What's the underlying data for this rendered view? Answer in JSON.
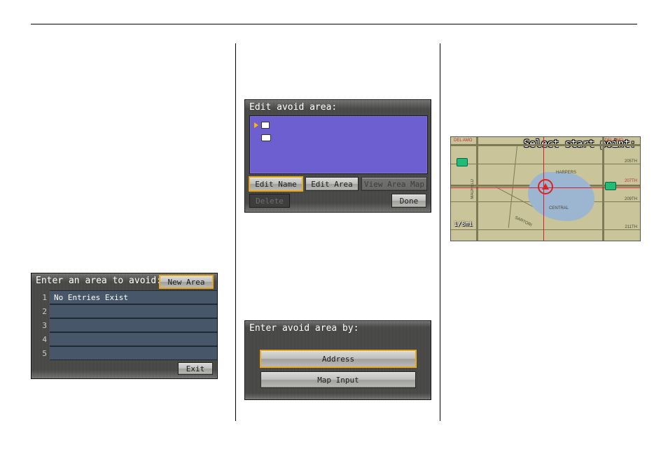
{
  "panel_enter_area": {
    "title": "Enter an area to avoid:",
    "new_area_label": "New Area",
    "rows": [
      {
        "num": "1",
        "text": "No Entries Exist"
      },
      {
        "num": "2",
        "text": ""
      },
      {
        "num": "3",
        "text": ""
      },
      {
        "num": "4",
        "text": ""
      },
      {
        "num": "5",
        "text": ""
      }
    ],
    "exit_label": "Exit"
  },
  "panel_edit_area": {
    "title": "Edit avoid area:",
    "buttons": {
      "edit_name": "Edit Name",
      "edit_area": "Edit Area",
      "view_map": "View Area Map",
      "delete": "Delete",
      "done": "Done"
    }
  },
  "panel_enter_by": {
    "title": "Enter avoid area by:",
    "address": "Address",
    "map_input": "Map Input"
  },
  "map": {
    "title": "Select start point:",
    "scale": "1/8mi",
    "streets": {
      "del_amo_left": "DEL AMO",
      "del_amo_right": "DEL AMO",
      "s205": "205TH",
      "s207": "207TH",
      "s209": "209TH",
      "s211": "211TH",
      "harpers": "HARPERS",
      "central": "CENTRAL",
      "sartori": "SARTORI",
      "madfeld": "MADFELD"
    }
  }
}
